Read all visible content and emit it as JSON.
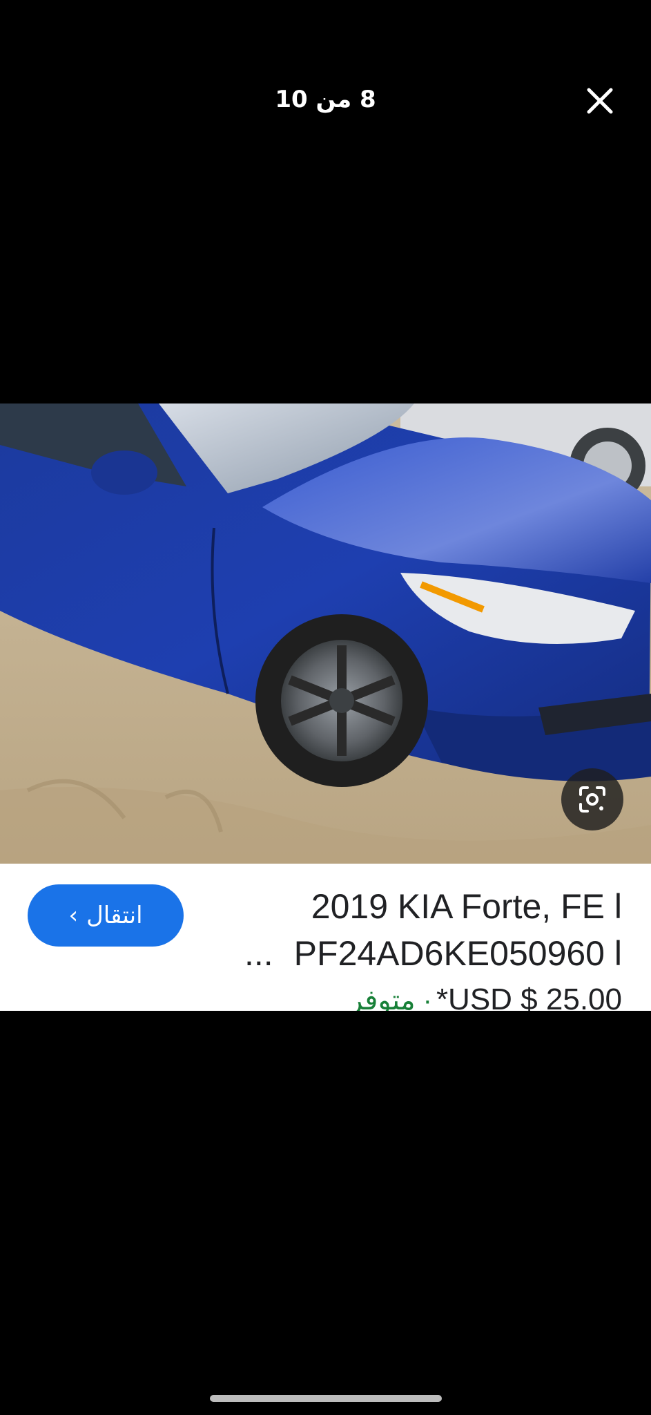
{
  "viewer": {
    "counter": "8 من 10",
    "close_icon": "close-icon"
  },
  "photo": {
    "subject": "blue sedan, front-left damage, on sand",
    "lens_icon": "google-lens-icon"
  },
  "result": {
    "title_line1": "2019 KIA Forte, FE l",
    "title_line2": "PF24AD6KE050960 l",
    "ellipsis": "...",
    "price": "*USD $ 25.00",
    "availability": "متوفر ·",
    "go_button": "انتقال",
    "go_chevron": "›",
    "accent_color": "#1a73e8",
    "availability_color": "#188038"
  }
}
